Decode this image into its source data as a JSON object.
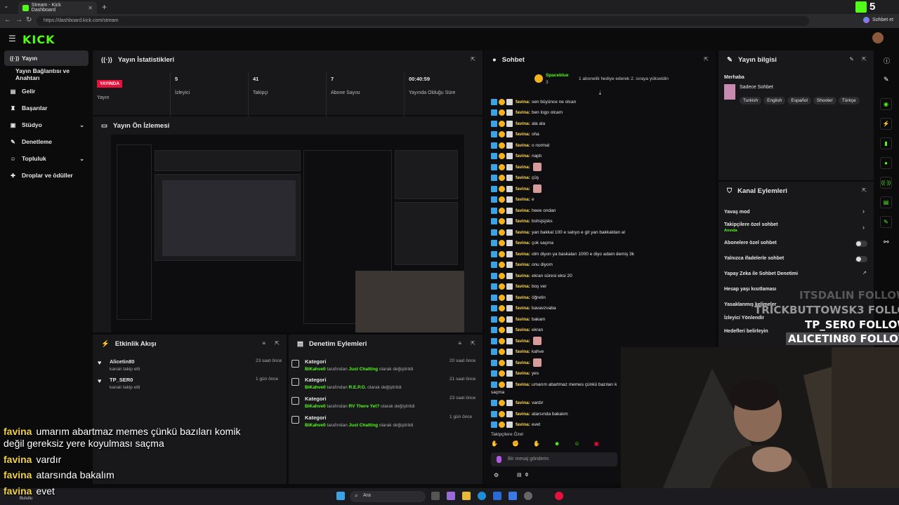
{
  "browser": {
    "tab_title": "Stream - Kick Dashboard",
    "url": "https://dashboard.kick.com/stream",
    "chat_button": "Sohbet et"
  },
  "app": {
    "logo": "KICK"
  },
  "sidebar": {
    "items": [
      {
        "label": "Yayın",
        "icon": "broadcast-icon"
      },
      {
        "label": "Yayın Bağlantısı ve Anahtarı"
      },
      {
        "label": "Gelir",
        "icon": "money-icon"
      },
      {
        "label": "Başarılar",
        "icon": "trophy-icon"
      },
      {
        "label": "Stüdyo",
        "icon": "studio-icon"
      },
      {
        "label": "Denetleme",
        "icon": "wrench-icon"
      },
      {
        "label": "Topluluk",
        "icon": "community-icon"
      },
      {
        "label": "Droplar ve ödüller",
        "icon": "gift-icon"
      }
    ]
  },
  "stats": {
    "title": "Yayın İstatistikleri",
    "live_badge": "YAYINDA",
    "status_label": "Yayın",
    "viewers_value": "5",
    "viewers_label": "İzleyici",
    "followers_value": "41",
    "followers_label": "Takipçi",
    "subs_value": "7",
    "subs_label": "Abone Sayısı",
    "uptime_value": "00:40:59",
    "uptime_label": "Yayında Olduğu Süre"
  },
  "preview": {
    "title": "Yayın Ön İzlemesi"
  },
  "activity": {
    "title": "Etkinlik Akışı",
    "items": [
      {
        "name": "Alicetin80",
        "sub": "kanalı takip etti",
        "time": "23 saat önce"
      },
      {
        "name": "TP_SER0",
        "sub": "kanalı takip etti",
        "time": "1 gün önce"
      }
    ]
  },
  "moderation": {
    "title": "Denetim Eylemleri",
    "items": [
      {
        "name": "Kategori",
        "actor": "BiKahve0",
        "mid": " tarafından ",
        "target": "Just Chatting",
        "end": " olarak değiştirildi",
        "time": "20 saat önce"
      },
      {
        "name": "Kategori",
        "actor": "BiKahve0",
        "mid": " tarafından ",
        "target": "R.E.P.O.",
        "end": " olarak değiştirildi",
        "time": "21 saat önce"
      },
      {
        "name": "Kategori",
        "actor": "BiKahve0",
        "mid": " tarafından ",
        "target": "RV There Yet?",
        "end": " olarak değiştirildi",
        "time": "23 saat önce"
      },
      {
        "name": "Kategori",
        "actor": "BiKahve0",
        "mid": " tarafından ",
        "target": "Just Chatting",
        "end": " olarak değiştirildi",
        "time": "1 gün önce"
      }
    ]
  },
  "chat": {
    "title": "Sohbet",
    "pinned_user": "Spaceblue",
    "pinned_count": "3",
    "pinned_text": "1 abonelik hediye ederek 2. sıraya yükseldin",
    "username": "favina:",
    "messages": [
      "sen büyünce ne olcan",
      "ben logo olcam",
      "ala ala",
      "oha",
      "o normal",
      "naptı",
      "",
      "çüş",
      "",
      "e",
      "heee ondan",
      "bshsjsjsks",
      "yan bakkal 100 e satıyo e git yan bakkaldan al",
      "çok saçma",
      "olm diyon ya baskaları 1000 e diyo adam demiş 3k",
      "onu diyom",
      "ekran süresi eksi 20",
      "boş ver",
      "öğretin",
      "bavavzvaba",
      "bakam",
      "ekran",
      "",
      "kahve",
      "",
      "yes",
      "umarım abartmaz memes çünkü bazıları k",
      "saçma",
      "vardır",
      "atarsında bakalım",
      "evet"
    ],
    "followers_only": "Takipçilere Özel",
    "input_placeholder": "Bir mesaj gönderin",
    "counter": "0"
  },
  "info": {
    "title": "Yayın bilgisi",
    "greeting": "Merhaba",
    "stream_title": "Sadece Sohbet",
    "tags": [
      "Turkish",
      "English",
      "Español",
      "Shooter",
      "Türkçe"
    ]
  },
  "channel_actions": {
    "title": "Kanal Eylemleri",
    "items": [
      "Yavaş mod",
      "Takipçilere özel sohbet",
      "Abonelere özel sohbet",
      "Yalnızca ifadelerle sohbet",
      "Yapay Zeka ile Sohbet Denetimi",
      "Hesap yaşı kısıtlaması",
      "Yasaklanmış kelimeler",
      "İzleyici Yönlendir",
      "Hedefleri belirleyin"
    ],
    "followers_sub": "Anında"
  },
  "overlay": {
    "follows": [
      "ITSDALIN",
      "TRICKBUTTOWSK3",
      "TP_SER0",
      "ALICETIN80"
    ],
    "follow_word": "FOLLOW",
    "chat": [
      {
        "user": "favina",
        "text": "umarım abartmaz memes çünkü bazıları komik"
      },
      {
        "user": "",
        "text": "değil gereksiz yere koyulması saçma"
      },
      {
        "user": "favina",
        "text": "vardır"
      },
      {
        "user": "favina",
        "text": "atarsında bakalım"
      },
      {
        "user": "favina",
        "text": "evet"
      }
    ],
    "kick_badge": "5"
  },
  "taskbar": {
    "weather": "Bulutlu",
    "search": "Ara"
  },
  "colors": {
    "accent": "#53fc18",
    "live": "#e9113c",
    "panel": "#18181b"
  }
}
